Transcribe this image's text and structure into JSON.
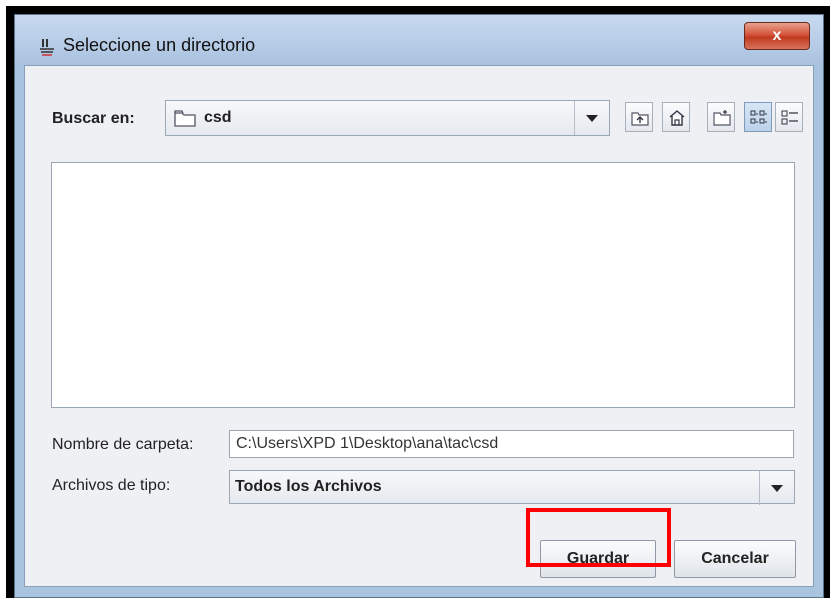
{
  "window": {
    "title": "Seleccione un directorio",
    "close_label": "x"
  },
  "lookin": {
    "label": "Buscar en:",
    "value": "csd"
  },
  "toolbar": {
    "icons": [
      "up-one-level-icon",
      "home-icon",
      "new-folder-icon",
      "list-view-icon",
      "details-view-icon"
    ],
    "active_view": "list-view"
  },
  "folder_name": {
    "label": "Nombre de carpeta:",
    "value": "C:\\Users\\XPD 1\\Desktop\\ana\\tac\\csd"
  },
  "file_type": {
    "label": "Archivos de tipo:",
    "value": "Todos los Archivos"
  },
  "buttons": {
    "save": "Guardar",
    "cancel": "Cancelar"
  },
  "colors": {
    "highlight": "#ff0000",
    "close_button": "#c9452b"
  }
}
